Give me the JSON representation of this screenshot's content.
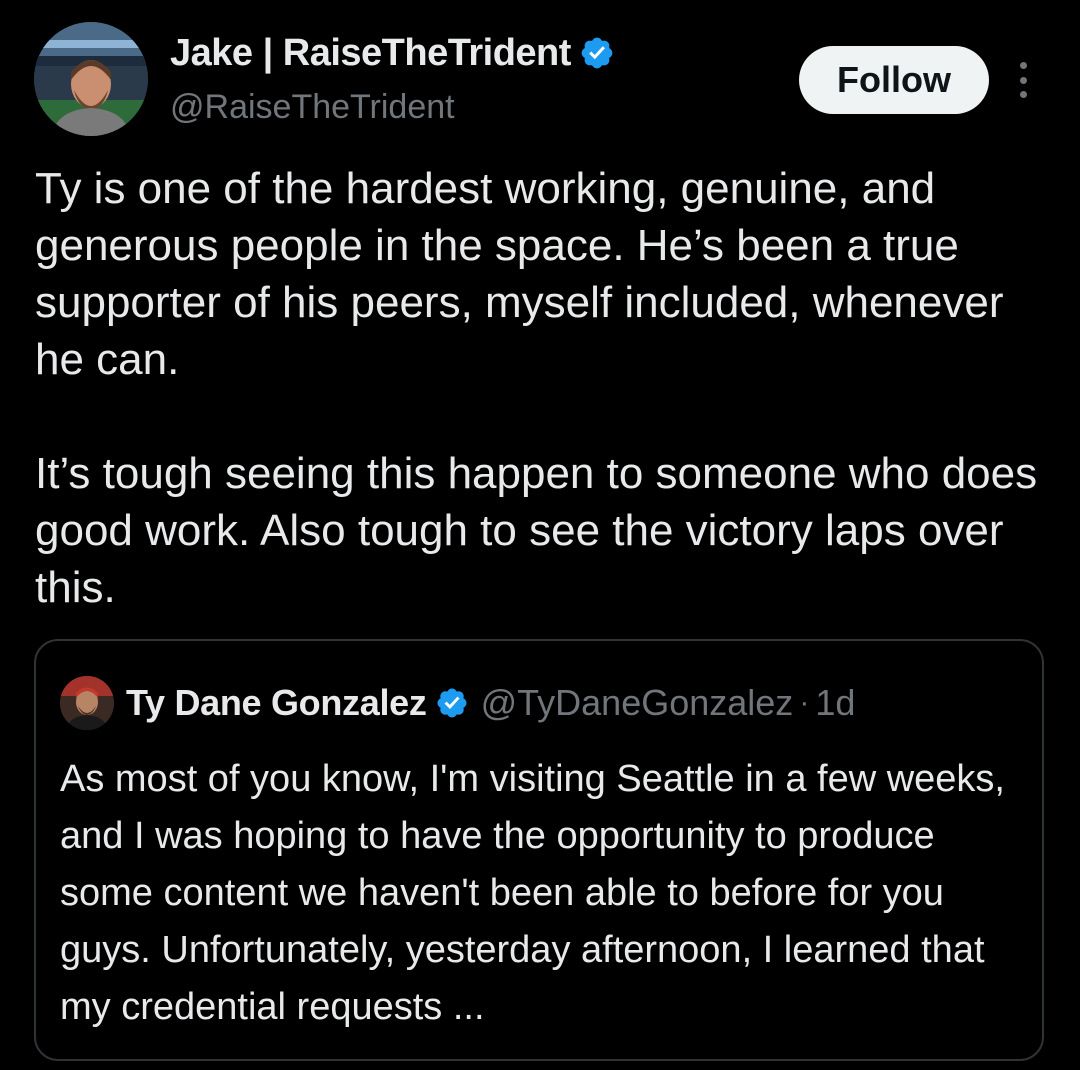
{
  "author": {
    "name": "Jake | RaiseTheTrident",
    "handle": "@RaiseTheTrident",
    "verified": true
  },
  "actions": {
    "follow_label": "Follow",
    "more_icon": "more-vertical-icon"
  },
  "tweet": {
    "paragraphs": [
      "Ty is one of the hardest working, genuine, and generous people in the space. He’s been a true supporter of his peers, myself included, whenever he can.",
      "It’s tough seeing this happen to someone who does good work. Also tough to see the victory laps over this."
    ]
  },
  "quote": {
    "name": "Ty Dane Gonzalez",
    "handle": "@TyDaneGonzalez",
    "separator": "·",
    "time": "1d",
    "verified": true,
    "text": "As most of you know, I'm visiting Seattle in a few weeks, and I was hoping to have the opportunity to produce some content we haven't been able to before for you guys. Unfortunately, yesterday afternoon, I learned that my credential requests ..."
  },
  "colors": {
    "background": "#000000",
    "text_primary": "#e7e9ea",
    "text_secondary": "#71767b",
    "verified_badge": "#1d9bf0",
    "follow_button_bg": "#eff3f4",
    "border": "#2f3336"
  }
}
